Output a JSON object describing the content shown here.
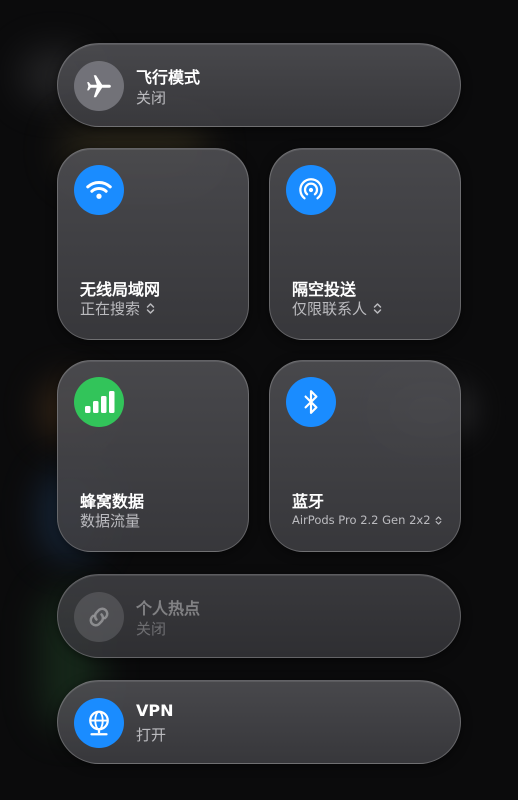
{
  "controls": {
    "airplane": {
      "title": "飞行模式",
      "status": "关闭",
      "icon": "airplane-icon"
    },
    "wifi": {
      "title": "无线局域网",
      "status": "正在搜索",
      "icon": "wifi-icon"
    },
    "airdrop": {
      "title": "隔空投送",
      "status": "仅限联系人",
      "icon": "airdrop-icon"
    },
    "cellular": {
      "title": "蜂窝数据",
      "status": "数据流量",
      "icon": "cellular-bars-icon"
    },
    "bluetooth": {
      "title": "蓝牙",
      "status": "AirPods Pro 2.2 Gen 2x2",
      "icon": "bluetooth-icon"
    },
    "hotspot": {
      "title": "个人热点",
      "status": "关闭",
      "icon": "hotspot-link-icon"
    },
    "vpn": {
      "title": "VPN",
      "status": "打开",
      "icon": "vpn-globe-icon"
    }
  },
  "colors": {
    "accent_blue": "#1a8cff",
    "accent_green": "#32c45a",
    "off_gray": "#78787e"
  }
}
